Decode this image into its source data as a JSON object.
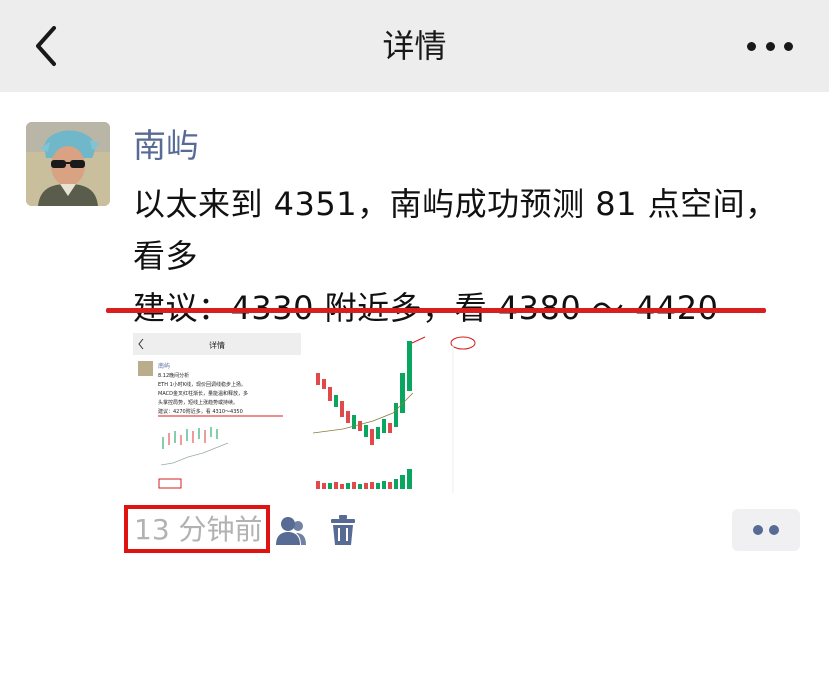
{
  "navbar": {
    "title": "详情",
    "back_icon": "chevron-left-icon",
    "more_icon": "more-dots-icon"
  },
  "post": {
    "author": "南屿",
    "lines": [
      "以太来到 4351，南屿成功预测 81 点空间，",
      "看多",
      "建议：4330 附近多，看 4380 ～ 4420"
    ],
    "highlight_color": "#d81e1e"
  },
  "attachment": {
    "thumb_header_title": "详情",
    "thumb_author": "南屿",
    "thumb_lines": [
      "8.12晚间分析",
      "ETH 1小时K线，现价回调线稳步上扬。",
      "MACD金叉红柱渐长，量能温和释放，多",
      "头掌控局势，短线上涨趋势或持续。",
      "建议：4270附近多，看 4310～4350"
    ]
  },
  "meta": {
    "time_ago": "13 分钟前",
    "contacts_icon": "contacts-icon",
    "delete_icon": "trash-icon",
    "comment_icon": "comment-dots-icon",
    "accent_color": "#576b95",
    "box_color": "#e01212"
  }
}
